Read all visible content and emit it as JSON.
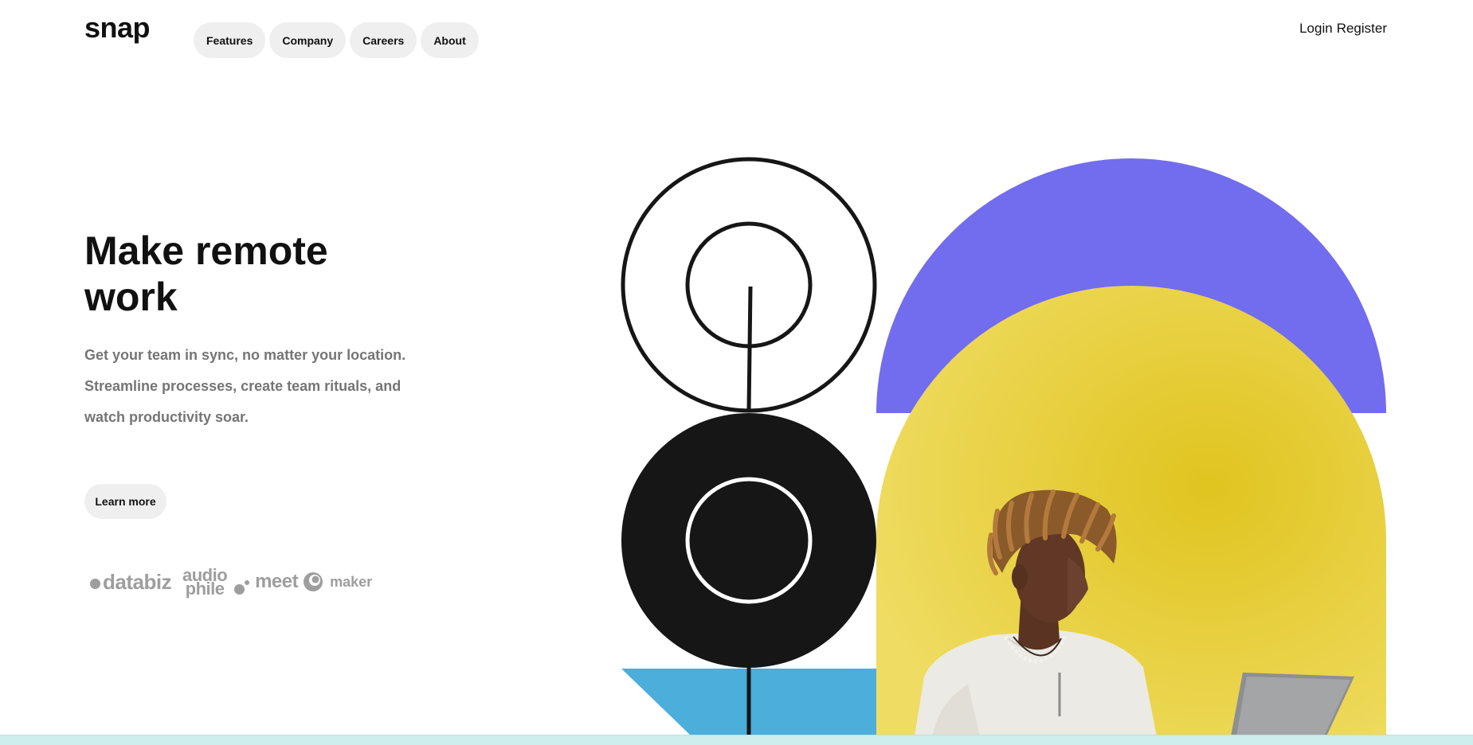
{
  "brand": {
    "name": "snap"
  },
  "nav": {
    "items": [
      "Features",
      "Company",
      "Careers",
      "About"
    ]
  },
  "auth": {
    "login": "Login",
    "register": "Register"
  },
  "hero": {
    "title": "Make remote work",
    "description": "Get your team in sync, no matter your location. Streamline processes, create team rituals, and watch productivity soar.",
    "cta_label": "Learn more"
  },
  "partners": {
    "databiz": "databiz",
    "audiophile_line1": "audio",
    "audiophile_line2": "phile",
    "meet": "meet",
    "maker": "maker"
  },
  "colors": {
    "purple": "#726cee",
    "yellow": "#e2cc32",
    "blue": "#4baedb",
    "black": "#161616",
    "pill": "#efefef",
    "muted_text": "#757575"
  }
}
